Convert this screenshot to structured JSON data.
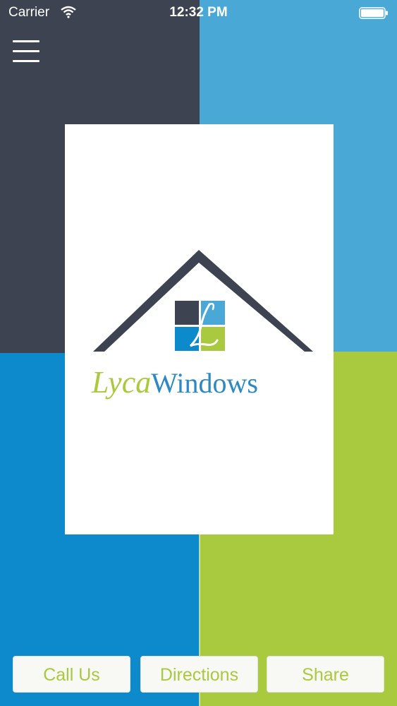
{
  "status_bar": {
    "carrier": "Carrier",
    "time": "12:32 PM",
    "wifi_icon": "wifi-icon",
    "battery_icon": "battery-icon"
  },
  "header": {
    "menu_icon": "hamburger-menu-icon"
  },
  "logo": {
    "brand_first": "Lyca",
    "brand_second": "Windows"
  },
  "actions": {
    "call_label": "Call Us",
    "directions_label": "Directions",
    "share_label": "Share"
  },
  "colors": {
    "dark_slate": "#3d4350",
    "light_blue": "#4aa8d6",
    "blue": "#0c8acb",
    "lime_green": "#a9c93e",
    "button_text": "#a9c93e"
  }
}
